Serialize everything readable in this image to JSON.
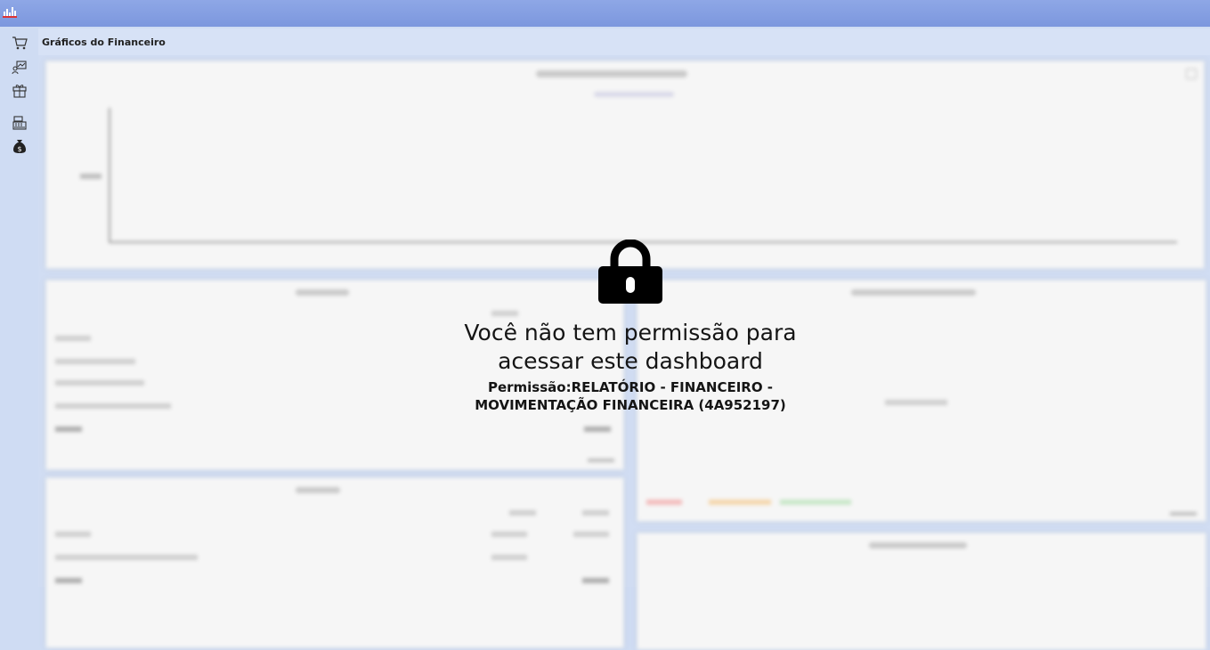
{
  "app": {
    "icon": "chart-icon"
  },
  "sidebar": {
    "items": [
      {
        "icon": "cart-icon"
      },
      {
        "icon": "sales-chart-icon"
      },
      {
        "icon": "gift-box-icon"
      },
      {
        "icon": "cash-register-icon"
      },
      {
        "icon": "money-bag-icon"
      }
    ]
  },
  "page": {
    "title": "Gráficos do Financeiro"
  },
  "lock_message": {
    "icon": "lock-icon",
    "line1": "Você não tem permissão para",
    "line2": "acessar este dashboard",
    "permission_line1": "Permissão:RELATÓRIO - FINANCEIRO -",
    "permission_line2": "MOVIMENTAÇÃO FINANCEIRA (4A952197)"
  }
}
